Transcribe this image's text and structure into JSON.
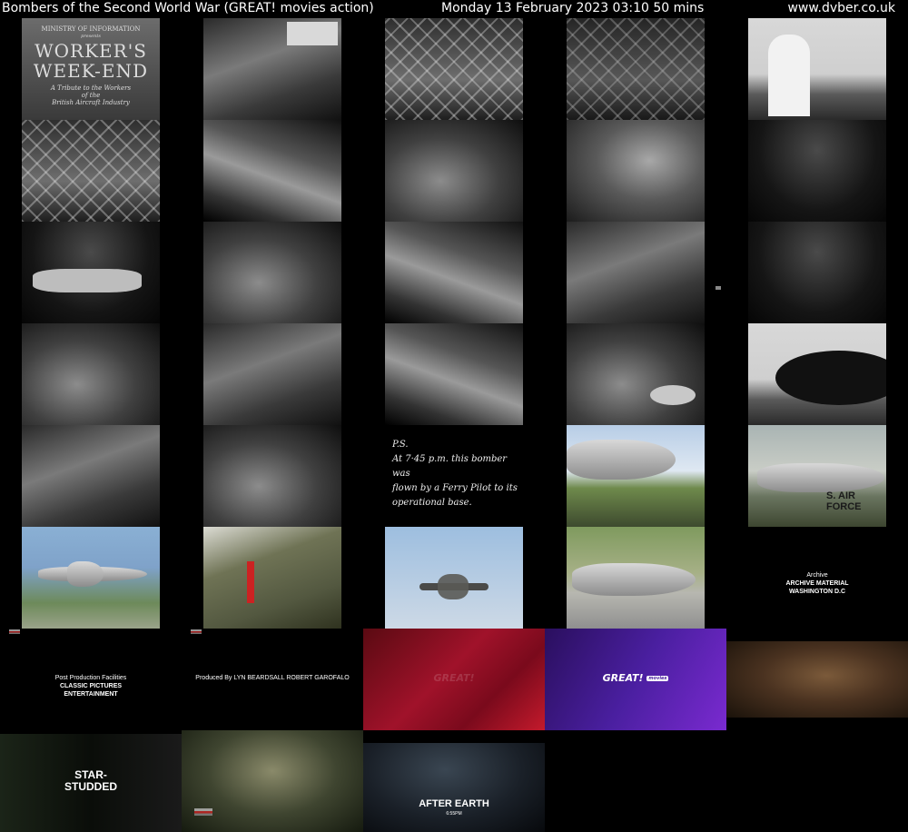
{
  "header": {
    "title": "Bombers of the Second World War (GREAT! movies action)",
    "datetime": "Monday 13 February 2023  03:10  50 mins",
    "site": "www.dvber.co.uk"
  },
  "thumb_text": {
    "poster": {
      "ministry": "MINISTRY OF INFORMATION",
      "presents": "presents",
      "title1": "WORKER'S",
      "title2": "WEEK-END",
      "tribute1": "A Tribute to the Workers",
      "tribute2": "of the",
      "tribute3": "British Aircraft Industry"
    },
    "ps": {
      "line1": "P.S.",
      "line2": "At 7·45 p.m. this bomber was",
      "line3": "flown by a Ferry Pilot to its",
      "line4": "operational base."
    },
    "air_force": "S. AIR FORCE",
    "archive": {
      "line1": "Archive",
      "line2": "ARCHIVE MATERIAL",
      "line3": "WASHINGTON D.C"
    },
    "post_production": {
      "line1": "Post Production Facilities",
      "line2": "CLASSIC PICTURES",
      "line3": "ENTERTAINMENT"
    },
    "produced_by": {
      "line1": "Produced By",
      "line2": "LYN BEARDSALL",
      "line3": "ROBERT GAROFALO"
    },
    "great_logo": "GREAT!",
    "great_sub": "movies",
    "star_studded1": "STAR-",
    "star_studded2": "STUDDED",
    "after_earth": "AFTER EARTH",
    "after_earth_time": "6:55PM"
  },
  "colors": {
    "background": "#000000",
    "header_text": "#ffffff",
    "great_red": "#a0122a",
    "great_purple": "#4a1fa0"
  }
}
